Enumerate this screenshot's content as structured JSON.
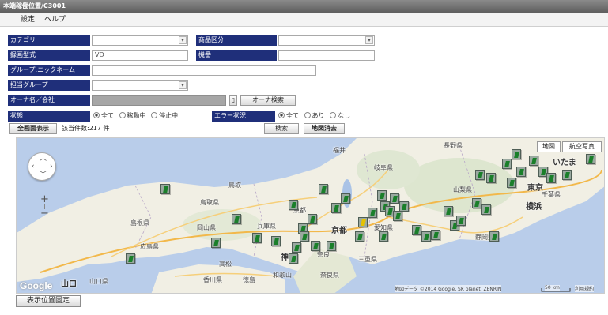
{
  "window": {
    "title": "本端稼働位置/C3001"
  },
  "menu": {
    "items": [
      "設定",
      "ヘルプ"
    ]
  },
  "form": {
    "category_label": "カテゴリ",
    "category_value": "",
    "product_type_label": "商品区分",
    "product_type_value": "",
    "model_label": "録画型式",
    "model_value": "VD",
    "serial_label": "機番",
    "serial_value": "",
    "group_nickname_label": "グループ:ニックネーム",
    "group_nickname_value": "",
    "assigned_group_label": "担当グループ",
    "assigned_group_value": "",
    "owner_label": "オーナ名／会社",
    "owner_value": "",
    "owner_search_button": "オーナ検索",
    "status_label": "状態",
    "status_options": [
      "全て",
      "稼動中",
      "停止中"
    ],
    "status_selected": "全て",
    "error_label": "エラー状況",
    "error_options": [
      "全て",
      "あり",
      "なし"
    ],
    "error_selected": "全て"
  },
  "toolbar": {
    "show_all_button": "全画面表示",
    "count_text": "該当件数:217 件",
    "search_button": "検索",
    "clear_button": "地図消去"
  },
  "map": {
    "map_button": "地図",
    "satellite_button": "航空写真",
    "zoom_in": "+",
    "zoom_out": "−",
    "attribution": "地図データ ©2014 Google, SK planet, ZENRIN",
    "scale": "50 km",
    "terms": "利用規約",
    "logo": "Google",
    "places": {
      "fukui": "福井",
      "gifu": "岐阜県",
      "nagano": "長野県",
      "saitama": "いたま",
      "tokyo": "東京",
      "yamanashi": "山梨県",
      "chiba": "千葉県",
      "yokohama": "横浜",
      "tottori": "鳥取",
      "tottori_pref": "鳥取県",
      "shimane": "島根県",
      "okayama": "岡山県",
      "hyogo": "兵庫県",
      "kyoto": "京都",
      "kyoto2": "京都",
      "aichi": "愛知県",
      "kobe": "神戸",
      "nara": "奈良",
      "mie": "三重県",
      "hiroshima": "広島県",
      "takamatsu": "高松",
      "wakayama": "和歌山",
      "nara_pref": "奈良県",
      "kagawa": "香川県",
      "tokushima": "徳島",
      "yamaguchi": "山口",
      "yamaguchi_pref": "山口県",
      "shizuoka": "静岡県"
    },
    "fix_position_button": "表示位置固定"
  }
}
